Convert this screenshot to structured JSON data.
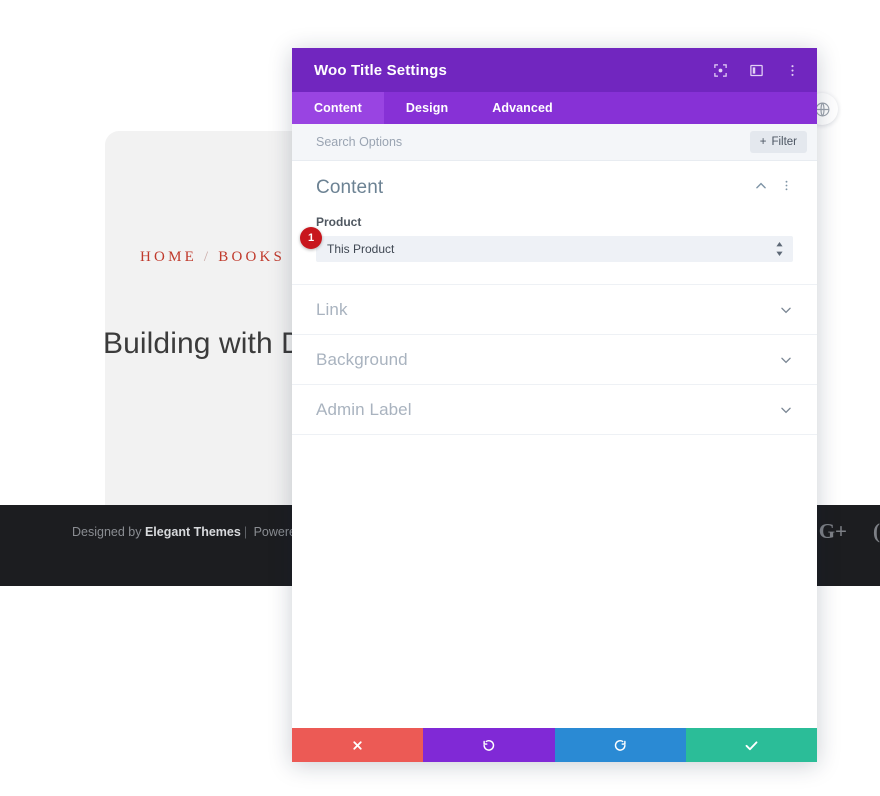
{
  "page": {
    "breadcrumb": {
      "home": "HOME",
      "separator": "/",
      "category": "BOOKS"
    },
    "heading": "Building with Div",
    "globe_icon": "globe-icon"
  },
  "footer": {
    "credit_prefix": "Designed by ",
    "credit_brand": "Elegant Themes",
    "credit_pipe": "|",
    "credit_suffix": " Powered b",
    "social": [
      {
        "name": "google-plus-icon",
        "glyph": "G+"
      },
      {
        "name": "social-icon-partial",
        "glyph": "("
      }
    ]
  },
  "modal": {
    "title": "Woo Title Settings",
    "header_icons": [
      {
        "name": "focus-target-icon"
      },
      {
        "name": "panel-layout-icon"
      },
      {
        "name": "overflow-menu-icon"
      }
    ],
    "tabs": [
      {
        "label": "Content",
        "active": true
      },
      {
        "label": "Design",
        "active": false
      },
      {
        "label": "Advanced",
        "active": false
      }
    ],
    "search": {
      "placeholder": "Search Options",
      "value": ""
    },
    "filter_button": {
      "label": "Filter",
      "plus": "+"
    },
    "content_section": {
      "title": "Content",
      "collapse_icon": "chevron-up-icon",
      "menu_icon": "overflow-menu-icon",
      "field": {
        "label": "Product",
        "selected_value": "This Product",
        "step_badge": "1"
      }
    },
    "collapsed_sections": [
      {
        "title": "Link",
        "icon": "chevron-down-icon"
      },
      {
        "title": "Background",
        "icon": "chevron-down-icon"
      },
      {
        "title": "Admin Label",
        "icon": "chevron-down-icon"
      }
    ],
    "actions": [
      {
        "name": "cancel-button",
        "icon": "close-x-icon",
        "color": "#ec5a55"
      },
      {
        "name": "undo-button",
        "icon": "undo-icon",
        "color": "#8029d6"
      },
      {
        "name": "redo-button",
        "icon": "redo-icon",
        "color": "#2a8ad4"
      },
      {
        "name": "save-button",
        "icon": "checkmark-icon",
        "color": "#2bbd98"
      }
    ]
  },
  "colors": {
    "header_purple": "#7126bf",
    "tabbar_purple": "#8731d6",
    "active_tab_purple": "#9944e2",
    "badge_red": "#c8161d",
    "breadcrumb_red": "#c0392b",
    "footer_dark": "#1c1d20"
  }
}
